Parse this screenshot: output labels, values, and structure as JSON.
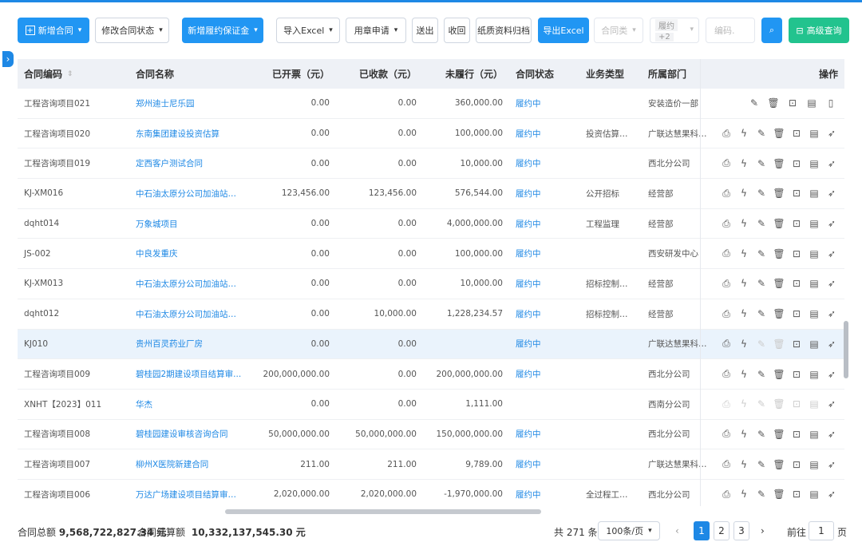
{
  "toolbar": {
    "new_contract": "新增合同",
    "modify_status": "修改合同状态",
    "new_bond": "新增履约保证金",
    "import_excel": "导入Excel",
    "seal_apply": "用章申请",
    "submit": "送出",
    "withdraw": "收回",
    "paper_archive": "纸质资料归档",
    "export_excel": "导出Excel",
    "contract_type": "合同类",
    "perform_top": "履约",
    "perform_count": "+2",
    "code_placeholder": "编码.",
    "advanced_search": "高级查询"
  },
  "table": {
    "headers": {
      "code": "合同编码",
      "name": "合同名称",
      "invoiced": "已开票（元）",
      "received": "已收款（元）",
      "unperformed": "未履行（元）",
      "status": "合同状态",
      "biz_type": "业务类型",
      "dept": "所属部门",
      "ops": "操作"
    },
    "rows": [
      {
        "code": "工程咨询项目021",
        "name": "郑州迪士尼乐园",
        "invoiced": "0.00",
        "received": "0.00",
        "unperformed": "360,000.00",
        "status": "履约中",
        "biz_type": "",
        "dept": "安装造价一部"
      },
      {
        "code": "工程咨询项目020",
        "name": "东南集团建设投资估算",
        "invoiced": "0.00",
        "received": "0.00",
        "unperformed": "100,000.00",
        "status": "履约中",
        "biz_type": "投资估算编制",
        "dept": "广联达慧果科技..."
      },
      {
        "code": "工程咨询项目019",
        "name": "定西客户测试合同",
        "invoiced": "0.00",
        "received": "0.00",
        "unperformed": "10,000.00",
        "status": "履约中",
        "biz_type": "",
        "dept": "西北分公司"
      },
      {
        "code": "KJ-XM016",
        "name": "中石油太原分公司加油站点...",
        "invoiced": "123,456.00",
        "received": "123,456.00",
        "unperformed": "576,544.00",
        "status": "履约中",
        "biz_type": "公开招标",
        "dept": "经营部"
      },
      {
        "code": "dqht014",
        "name": "万象城项目",
        "invoiced": "0.00",
        "received": "0.00",
        "unperformed": "4,000,000.00",
        "status": "履约中",
        "biz_type": "工程监理",
        "dept": "经营部"
      },
      {
        "code": "JS-002",
        "name": "中良发重庆",
        "invoiced": "0.00",
        "received": "0.00",
        "unperformed": "100,000.00",
        "status": "履约中",
        "biz_type": "",
        "dept": "西安研发中心"
      },
      {
        "code": "KJ-XM013",
        "name": "中石油太原分公司加油站装...",
        "invoiced": "0.00",
        "received": "0.00",
        "unperformed": "10,000.00",
        "status": "履约中",
        "biz_type": "招标控制价...",
        "dept": "经营部"
      },
      {
        "code": "dqht012",
        "name": "中石油太原分公司加油站装...",
        "invoiced": "0.00",
        "received": "10,000.00",
        "unperformed": "1,228,234.57",
        "status": "履约中",
        "biz_type": "招标控制价...",
        "dept": "经营部"
      },
      {
        "code": "KJ010",
        "name": "贵州百灵药业厂房",
        "invoiced": "0.00",
        "received": "0.00",
        "unperformed": "",
        "status": "履约中",
        "biz_type": "",
        "dept": "广联达慧果科技..."
      },
      {
        "code": "工程咨询项目009",
        "name": "碧桂园2期建设项目结算审...",
        "invoiced": "200,000,000.00",
        "received": "0.00",
        "unperformed": "200,000,000.00",
        "status": "履约中",
        "biz_type": "",
        "dept": "西北分公司"
      },
      {
        "code": "XNHT【2023】011",
        "name": "华杰",
        "invoiced": "0.00",
        "received": "0.00",
        "unperformed": "1,111.00",
        "status": "",
        "biz_type": "",
        "dept": "西南分公司"
      },
      {
        "code": "工程咨询项目008",
        "name": "碧桂园建设审核咨询合同",
        "invoiced": "50,000,000.00",
        "received": "50,000,000.00",
        "unperformed": "150,000,000.00",
        "status": "履约中",
        "biz_type": "",
        "dept": "西北分公司"
      },
      {
        "code": "工程咨询项目007",
        "name": "柳州X医院新建合同",
        "invoiced": "211.00",
        "received": "211.00",
        "unperformed": "9,789.00",
        "status": "履约中",
        "biz_type": "",
        "dept": "广联达慧果科技..."
      },
      {
        "code": "工程咨询项目006",
        "name": "万达广场建设项目结算审核...",
        "invoiced": "2,020,000.00",
        "received": "2,020,000.00",
        "unperformed": "-1,970,000.00",
        "status": "履约中",
        "biz_type": "全过程工程...",
        "dept": "西北分公司"
      }
    ]
  },
  "footer": {
    "total_contract_label": "合同总额",
    "total_contract_value": "9,568,722,827.34 元",
    "settle_label": "合同结算额",
    "settle_value": "10,332,137,545.30 元",
    "total_count": "共 271 条",
    "page_size": "100条/页",
    "pages": [
      "1",
      "2",
      "3"
    ],
    "goto_label": "前往",
    "goto_value": "1",
    "page_unit": "页"
  },
  "colors": {
    "primary": "#2196f3",
    "success": "#22c38e",
    "link": "#1e88e5"
  }
}
